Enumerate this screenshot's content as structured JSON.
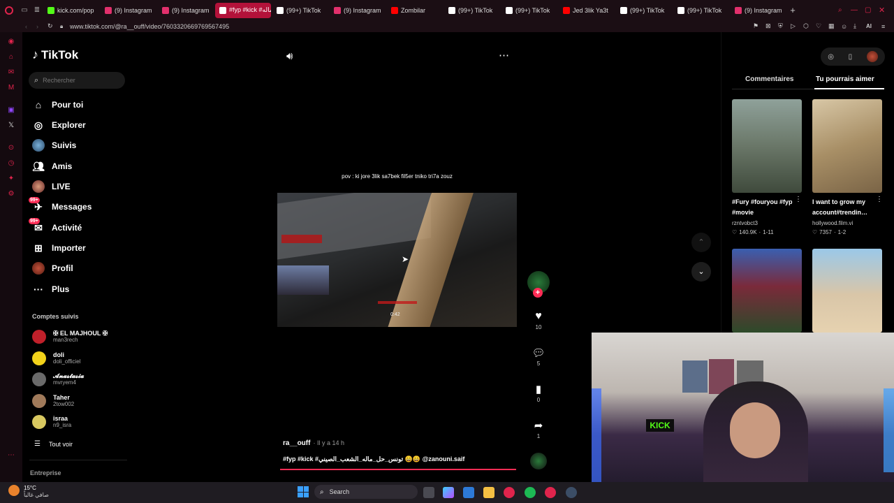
{
  "browser": {
    "tabs": [
      {
        "label": "kick.com/pop",
        "color": "#53fc18",
        "active": false
      },
      {
        "label": "(9) Instagram",
        "color": "#e1306c",
        "active": false
      },
      {
        "label": "(9) Instagram",
        "color": "#e1306c",
        "active": false
      },
      {
        "label": "#fyp #kick #ـحل_ماله",
        "color": "#ffffff",
        "active": true
      },
      {
        "label": "(99+) TikTok",
        "color": "#ffffff",
        "active": false
      },
      {
        "label": "(9) Instagram",
        "color": "#e1306c",
        "active": false
      },
      {
        "label": "Zombilar",
        "color": "#ff0000",
        "active": false
      },
      {
        "label": "(99+) TikTok",
        "color": "#ffffff",
        "active": false
      },
      {
        "label": "(99+) TikTok",
        "color": "#ffffff",
        "active": false
      },
      {
        "label": "Jed 3lik Ya3t",
        "color": "#ff0000",
        "active": false
      },
      {
        "label": "(99+) TikTok",
        "color": "#ffffff",
        "active": false
      },
      {
        "label": "(99+) TikTok",
        "color": "#ffffff",
        "active": false
      },
      {
        "label": "(9) Instagram",
        "color": "#e1306c",
        "active": false
      }
    ],
    "url": "www.tiktok.com/@ra__ouff/video/7603320669769567495"
  },
  "sidebar": {
    "logo": "TikTok",
    "search_placeholder": "Rechercher",
    "nav": [
      {
        "label": "Pour toi",
        "icon": "home-icon"
      },
      {
        "label": "Explorer",
        "icon": "compass-icon"
      },
      {
        "label": "Suivis",
        "icon": "avatar"
      },
      {
        "label": "Amis",
        "icon": "friends-icon"
      },
      {
        "label": "LIVE",
        "icon": "live-icon"
      },
      {
        "label": "Messages",
        "icon": "messages-icon",
        "badge": "99+"
      },
      {
        "label": "Activité",
        "icon": "activity-icon",
        "badge": "99+"
      },
      {
        "label": "Importer",
        "icon": "upload-icon"
      },
      {
        "label": "Profil",
        "icon": "profile-avatar"
      },
      {
        "label": "Plus",
        "icon": "more-icon"
      }
    ],
    "following_title": "Comptes suivis",
    "accounts": [
      {
        "name": "✠ EL MAJHOUL ✠",
        "handle": "man3rech"
      },
      {
        "name": "doli",
        "handle": "doli_officiel"
      },
      {
        "name": "𝓐𝓷𝓪𝓼𝓽𝓪𝓼𝓲𝓪",
        "handle": "mvryem4"
      },
      {
        "name": "Taher",
        "handle": "2tow002"
      },
      {
        "name": "israa",
        "handle": "n9_isra"
      }
    ],
    "see_all": "Tout voir",
    "footer": "Entreprise"
  },
  "video": {
    "overlay_text": "pov : ki jore 3lik sa7bek fil5er tniko tri7a zouz",
    "timer": "0:42",
    "author": "ra__ouff",
    "time_ago": "· Il y a 14 h",
    "caption": "#fyp #kick #تونس_حل_ماله_الشعب_الصيني 😄😄 @zanouni.saif",
    "likes": "10",
    "comments": "5",
    "saves": "0",
    "shares": "1"
  },
  "right_panel": {
    "tabs": [
      "Commentaires",
      "Tu pourrais aimer"
    ],
    "active_tab": "Tu pourrais aimer",
    "cards": [
      {
        "title": "#Fury #fouryou #fyp #movie",
        "author": "rzntvobct3",
        "views": "140.9K",
        "date": "1-11"
      },
      {
        "title": "I want to grow my account#trendin…",
        "author": "hollywood.film.vi",
        "views": "7357",
        "date": "1-2"
      }
    ]
  },
  "taskbar": {
    "temp": "15°C",
    "weather": "صافي غالباً",
    "search": "Search"
  },
  "colors": {
    "accent": "#fe2c55",
    "browser_accent": "#b3123a"
  }
}
